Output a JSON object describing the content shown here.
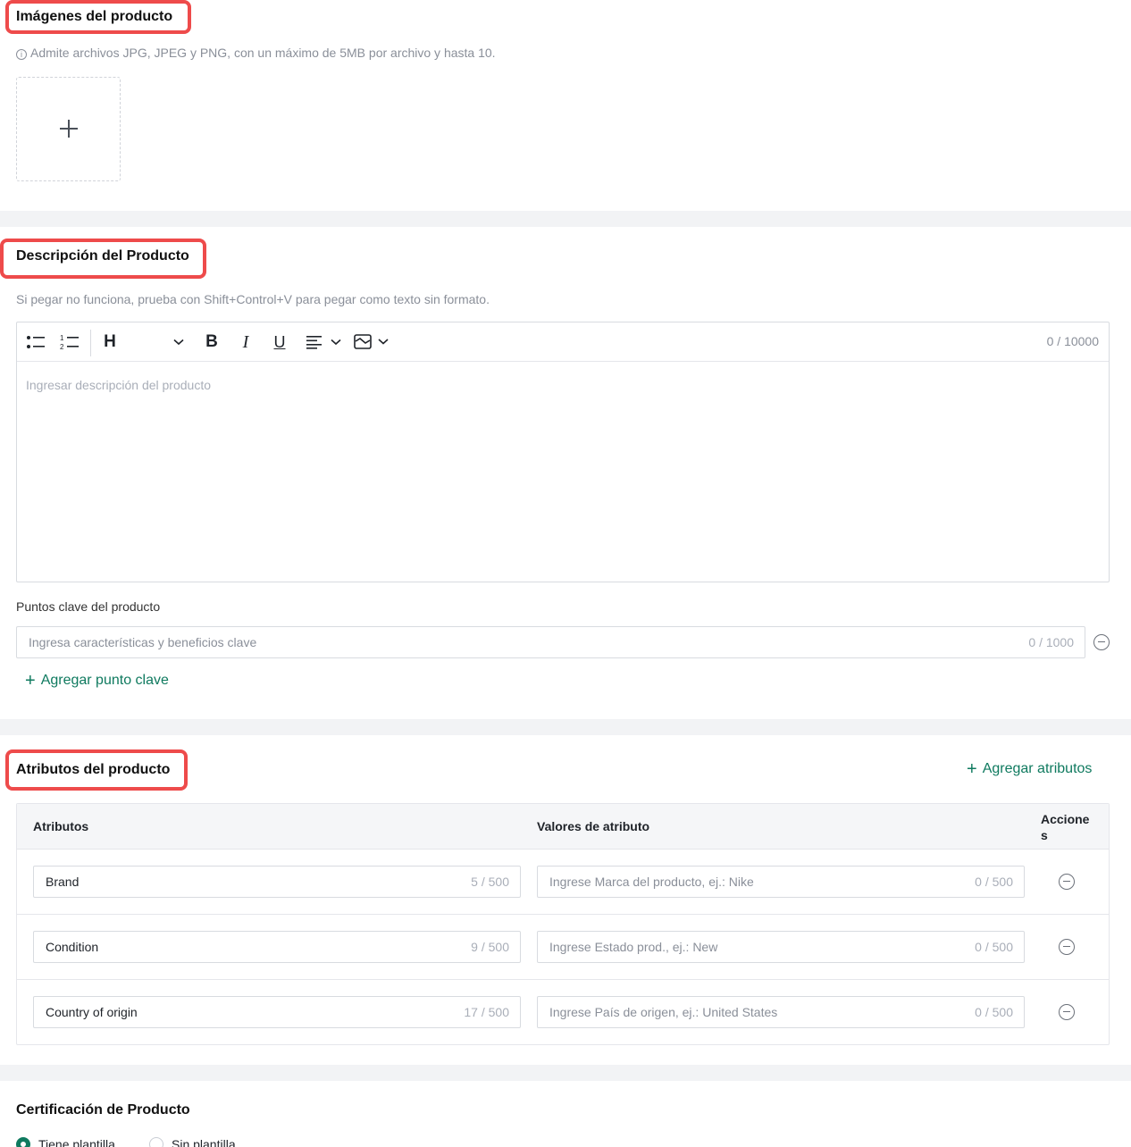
{
  "images_section": {
    "title": "Imágenes del producto",
    "hint": "Admite archivos JPG, JPEG y PNG, con un máximo de 5MB por archivo y hasta 10.",
    "upload_icon": "plus-icon"
  },
  "description_section": {
    "title": "Descripción del Producto",
    "hint": "Si pegar no funciona, prueba con Shift+Control+V para pegar como texto sin formato.",
    "toolbar": {
      "heading_label": "H",
      "bold_label": "B",
      "italic_label": "I",
      "underline_label": "U",
      "icons": [
        "bullet-list-icon",
        "numbered-list-icon",
        "heading-icon",
        "chevron-down-icon",
        "bold-icon",
        "italic-icon",
        "underline-icon",
        "align-icon",
        "image-icon"
      ]
    },
    "counter": "0 / 10000",
    "placeholder": "Ingresar descripción del producto",
    "key_points": {
      "label": "Puntos clave del producto",
      "placeholder": "Ingresa características y beneficios clave",
      "counter": "0 / 1000",
      "add_label": "Agregar punto clave"
    }
  },
  "attributes_section": {
    "title": "Atributos del producto",
    "add_label": "Agregar atributos",
    "headers": {
      "attribute": "Atributos",
      "value": "Valores de atributo",
      "actions_line1": "Accione",
      "actions_line2": "s"
    },
    "rows": [
      {
        "name": "Brand",
        "name_counter": "5 / 500",
        "value_placeholder": "Ingrese Marca del producto, ej.: Nike",
        "value_counter": "0 / 500"
      },
      {
        "name": "Condition",
        "name_counter": "9 / 500",
        "value_placeholder": "Ingrese Estado prod., ej.: New",
        "value_counter": "0 / 500"
      },
      {
        "name": "Country of origin",
        "name_counter": "17 / 500",
        "value_placeholder": "Ingrese País de origen, ej.: United States",
        "value_counter": "0 / 500"
      }
    ]
  },
  "certification_section": {
    "title": "Certificación de Producto",
    "options": [
      {
        "label": "Tiene plantilla",
        "selected": true
      },
      {
        "label": "Sin plantilla",
        "selected": false
      }
    ]
  },
  "colors": {
    "highlight": "#ee4b4b",
    "accent": "#0f7a5f",
    "divider": "#f2f3f5"
  }
}
